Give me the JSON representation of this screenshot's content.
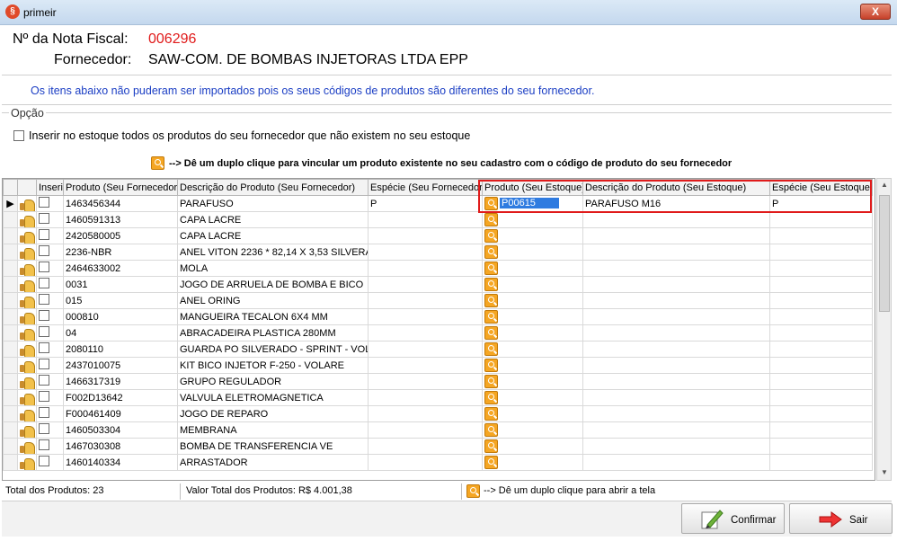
{
  "window": {
    "title": "primeir",
    "close_label": "X"
  },
  "header": {
    "nf_label": "Nº da Nota Fiscal:",
    "nf_value": "006296",
    "fornecedor_label": "Fornecedor:",
    "fornecedor_value": "SAW-COM. DE BOMBAS INJETORAS LTDA EPP"
  },
  "info_text": "Os itens abaixo não puderam ser importados pois os seus códigos de produtos são diferentes do seu fornecedor.",
  "opcao": {
    "legend": "Opção",
    "checkbox_label": "Inserir no estoque todos os produtos do seu fornecedor que não existem no seu estoque"
  },
  "hint": "--> Dê um duplo clique para vincular um produto existente no seu cadastro com o código de produto do seu fornecedor",
  "grid": {
    "columns": {
      "inserir": "Inserir",
      "prod_forn": "Produto (Seu Fornecedor)",
      "desc_forn": "Descrição do Produto (Seu Fornecedor)",
      "esp_forn": "Espécie (Seu Fornecedor)",
      "prod_est": "Produto (Seu Estoque)",
      "desc_est": "Descrição do Produto (Seu Estoque)",
      "esp_est": "Espécie (Seu Estoque)"
    },
    "rows": [
      {
        "prod_forn": "1463456344",
        "desc_forn": "PARAFUSO",
        "esp_forn": "P",
        "prod_est": "P00615",
        "desc_est": "PARAFUSO M16",
        "esp_est": "P"
      },
      {
        "prod_forn": "1460591313",
        "desc_forn": "CAPA LACRE",
        "esp_forn": "",
        "prod_est": "",
        "desc_est": "",
        "esp_est": ""
      },
      {
        "prod_forn": "2420580005",
        "desc_forn": "CAPA LACRE",
        "esp_forn": "",
        "prod_est": "",
        "desc_est": "",
        "esp_est": ""
      },
      {
        "prod_forn": "2236-NBR",
        "desc_forn": "ANEL VITON 2236 * 82,14 X 3,53 SILVERA",
        "esp_forn": "",
        "prod_est": "",
        "desc_est": "",
        "esp_est": ""
      },
      {
        "prod_forn": "2464633002",
        "desc_forn": "MOLA",
        "esp_forn": "",
        "prod_est": "",
        "desc_est": "",
        "esp_est": ""
      },
      {
        "prod_forn": "0031",
        "desc_forn": "JOGO DE ARRUELA DE BOMBA E BICO",
        "esp_forn": "",
        "prod_est": "",
        "desc_est": "",
        "esp_est": ""
      },
      {
        "prod_forn": "015",
        "desc_forn": "ANEL ORING",
        "esp_forn": "",
        "prod_est": "",
        "desc_est": "",
        "esp_est": ""
      },
      {
        "prod_forn": "000810",
        "desc_forn": "MANGUEIRA TECALON 6X4 MM",
        "esp_forn": "",
        "prod_est": "",
        "desc_est": "",
        "esp_est": ""
      },
      {
        "prod_forn": "04",
        "desc_forn": "ABRACADEIRA PLASTICA 280MM",
        "esp_forn": "",
        "prod_est": "",
        "desc_est": "",
        "esp_est": ""
      },
      {
        "prod_forn": "2080110",
        "desc_forn": "GUARDA PO SILVERADO - SPRINT - VOL",
        "esp_forn": "",
        "prod_est": "",
        "desc_est": "",
        "esp_est": ""
      },
      {
        "prod_forn": "2437010075",
        "desc_forn": "KIT BICO INJETOR F-250 - VOLARE",
        "esp_forn": "",
        "prod_est": "",
        "desc_est": "",
        "esp_est": ""
      },
      {
        "prod_forn": "1466317319",
        "desc_forn": "GRUPO REGULADOR",
        "esp_forn": "",
        "prod_est": "",
        "desc_est": "",
        "esp_est": ""
      },
      {
        "prod_forn": "F002D13642",
        "desc_forn": "VALVULA ELETROMAGNETICA",
        "esp_forn": "",
        "prod_est": "",
        "desc_est": "",
        "esp_est": ""
      },
      {
        "prod_forn": "F000461409",
        "desc_forn": "JOGO DE REPARO",
        "esp_forn": "",
        "prod_est": "",
        "desc_est": "",
        "esp_est": ""
      },
      {
        "prod_forn": "1460503304",
        "desc_forn": "MEMBRANA",
        "esp_forn": "",
        "prod_est": "",
        "desc_est": "",
        "esp_est": ""
      },
      {
        "prod_forn": "1467030308",
        "desc_forn": "BOMBA DE TRANSFERENCIA VE",
        "esp_forn": "",
        "prod_est": "",
        "desc_est": "",
        "esp_est": ""
      },
      {
        "prod_forn": "1460140334",
        "desc_forn": "ARRASTADOR",
        "esp_forn": "",
        "prod_est": "",
        "desc_est": "",
        "esp_est": ""
      }
    ]
  },
  "footer": {
    "total_produtos": "Total dos Produtos: 23",
    "valor_total": "Valor Total dos Produtos: R$ 4.001,38",
    "hint": "--> Dê um duplo clique para abrir a tela"
  },
  "buttons": {
    "confirmar": "Confirmar",
    "sair": "Sair"
  },
  "colors": {
    "accent_red": "#e01b1b",
    "info_blue": "#1c3fc4",
    "selection_blue": "#2f7be0",
    "search_orange": "#f5a623"
  }
}
